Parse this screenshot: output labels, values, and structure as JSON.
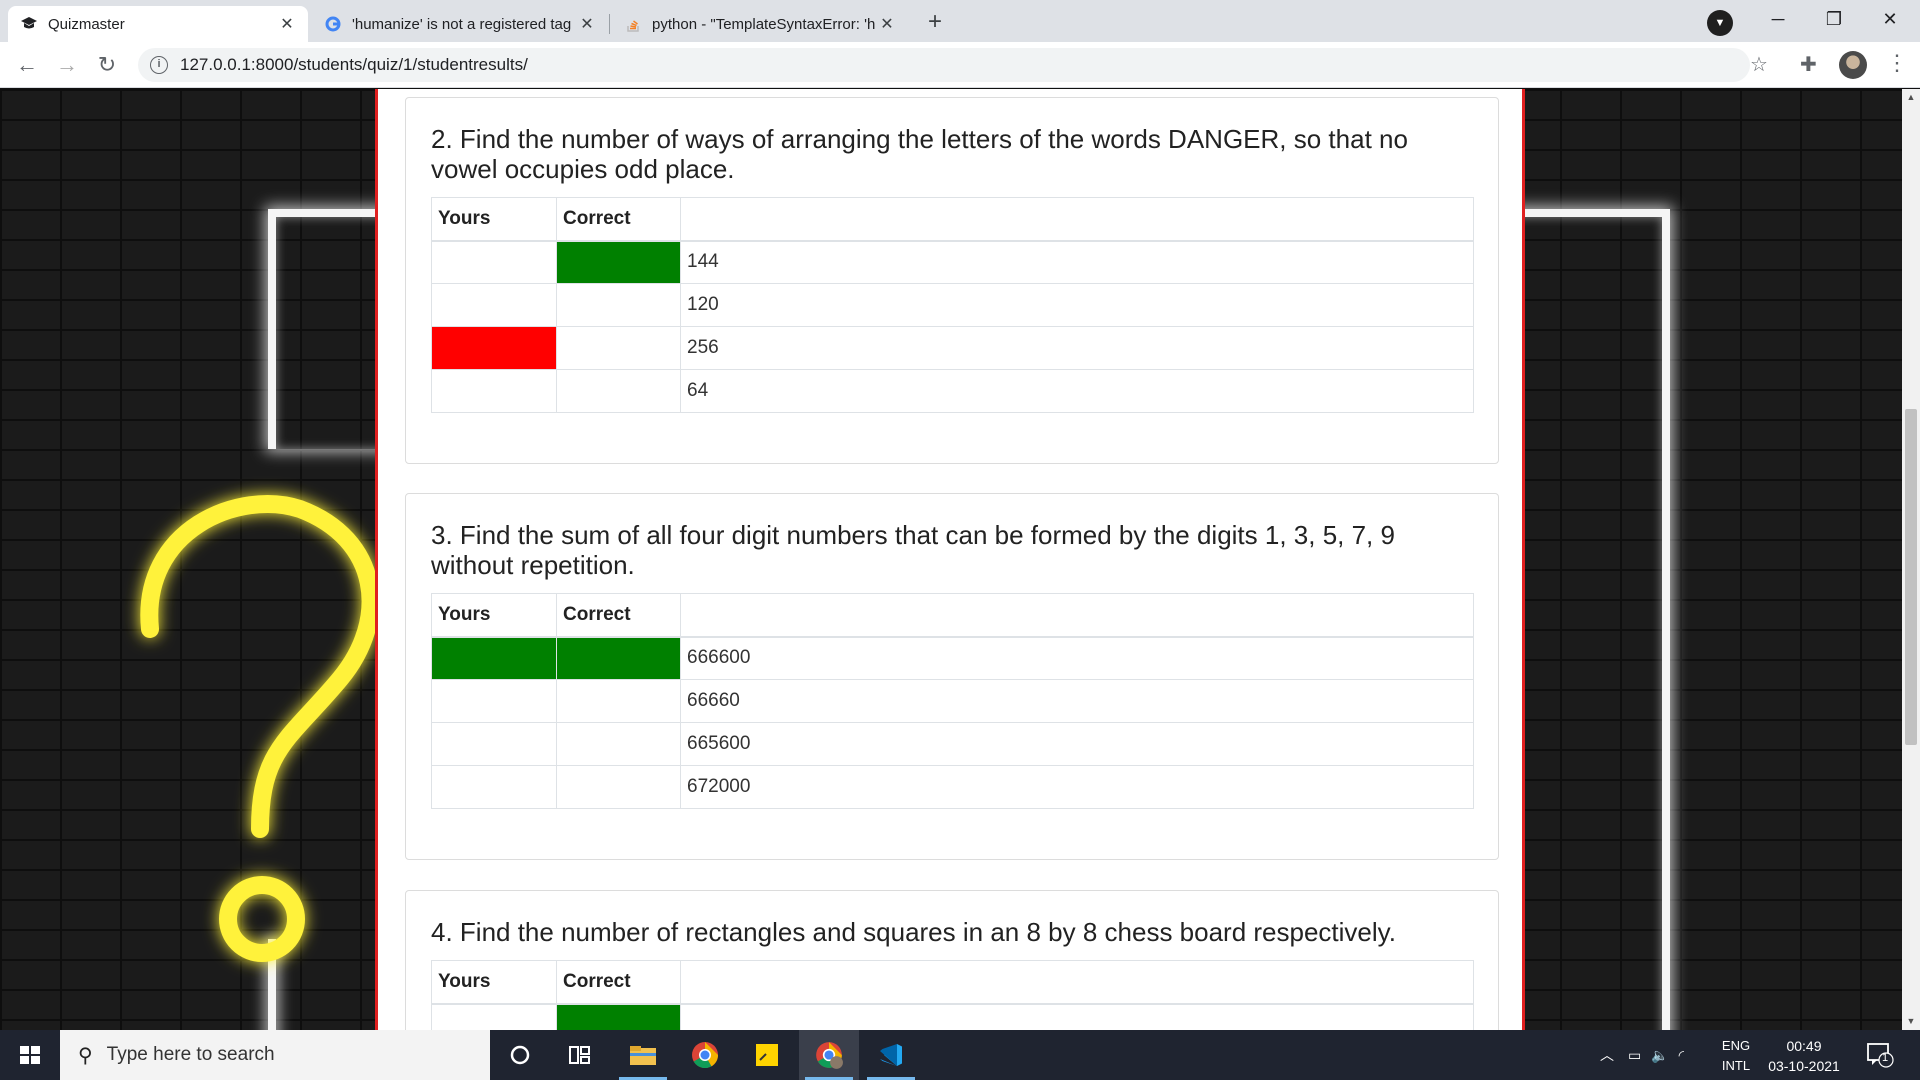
{
  "browser": {
    "tabs": [
      {
        "title": "Quizmaster",
        "icon": "graduation-cap-icon",
        "active": true
      },
      {
        "title": "'humanize' is not a registered tag",
        "icon": "google-icon",
        "active": false
      },
      {
        "title": "python - \"TemplateSyntaxError: 'h",
        "icon": "stackoverflow-icon",
        "active": false
      }
    ],
    "url": "127.0.0.1:8000/students/quiz/1/studentresults/"
  },
  "quiz": {
    "header_yours": "Yours",
    "header_correct": "Correct",
    "questions": [
      {
        "title": "2. Find the number of ways of arranging the letters of the words DANGER, so that no vowel occupies odd place.",
        "options": [
          {
            "text": "144",
            "yours": false,
            "correct": true
          },
          {
            "text": "120",
            "yours": false,
            "correct": false
          },
          {
            "text": "256",
            "yours": true,
            "correct": false
          },
          {
            "text": "64",
            "yours": false,
            "correct": false
          }
        ]
      },
      {
        "title": "3. Find the sum of all four digit numbers that can be formed by the digits 1, 3, 5, 7, 9 without repetition.",
        "options": [
          {
            "text": "666600",
            "yours": true,
            "correct": true
          },
          {
            "text": "66660",
            "yours": false,
            "correct": false
          },
          {
            "text": "665600",
            "yours": false,
            "correct": false
          },
          {
            "text": "672000",
            "yours": false,
            "correct": false
          }
        ]
      },
      {
        "title": "4. Find the number of rectangles and squares in an 8 by 8 chess board respectively.",
        "options": [
          {
            "text": "",
            "yours": false,
            "correct": true
          }
        ]
      }
    ]
  },
  "colors": {
    "correct": "#008000",
    "wrong": "#ff0000",
    "border": "#e02020"
  },
  "taskbar": {
    "search_placeholder": "Type here to search",
    "lang_line1": "ENG",
    "lang_line2": "INTL",
    "time": "00:49",
    "date": "03-10-2021",
    "notifications": "1"
  }
}
